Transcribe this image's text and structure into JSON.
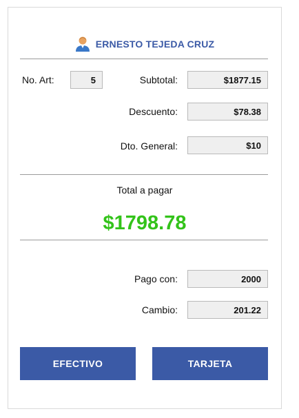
{
  "customer": {
    "name": "ERNESTO TEJEDA CRUZ",
    "icon": "user-icon"
  },
  "summary": {
    "items_label": "No. Art:",
    "items_value": "5",
    "subtotal_label": "Subtotal:",
    "subtotal_value": "$1877.15",
    "discount_label": "Descuento:",
    "discount_value": "$78.38",
    "general_discount_label": "Dto. General:",
    "general_discount_value": "$10"
  },
  "total": {
    "label": "Total a pagar",
    "amount": "$1798.78"
  },
  "payment": {
    "paid_label": "Pago con:",
    "paid_value": "2000",
    "change_label": "Cambio:",
    "change_value": "201.22"
  },
  "actions": {
    "cash_label": "EFECTIVO",
    "card_label": "TARJETA"
  },
  "colors": {
    "accent": "#3b5aa6",
    "total_green": "#33c31a",
    "field_bg": "#efefef"
  }
}
